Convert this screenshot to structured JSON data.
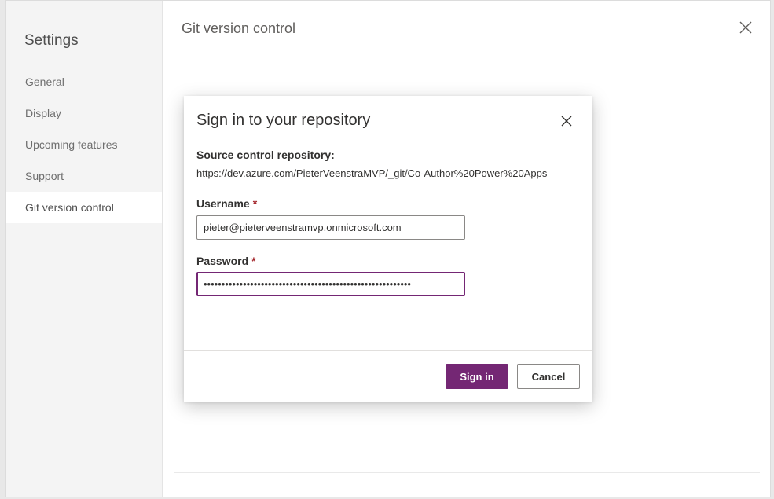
{
  "settings": {
    "title": "Settings",
    "nav_items": [
      {
        "label": "General"
      },
      {
        "label": "Display"
      },
      {
        "label": "Upcoming features"
      },
      {
        "label": "Support"
      },
      {
        "label": "Git version control",
        "active": true
      }
    ]
  },
  "content": {
    "title": "Git version control"
  },
  "dialog": {
    "title": "Sign in to your repository",
    "repo_label": "Source control repository:",
    "repo_url": "https://dev.azure.com/PieterVeenstraMVP/_git/Co-Author%20Power%20Apps",
    "username_label": "Username",
    "username_value": "pieter@pieterveenstramvp.onmicrosoft.com",
    "password_label": "Password",
    "password_value": "••••••••••••••••••••••••••••••••••••••••••••••••••••••••••",
    "required_marker": "*",
    "sign_in_label": "Sign in",
    "cancel_label": "Cancel"
  },
  "colors": {
    "accent": "#742774",
    "required": "#a4262c"
  },
  "icons": {
    "close": "close-icon"
  }
}
